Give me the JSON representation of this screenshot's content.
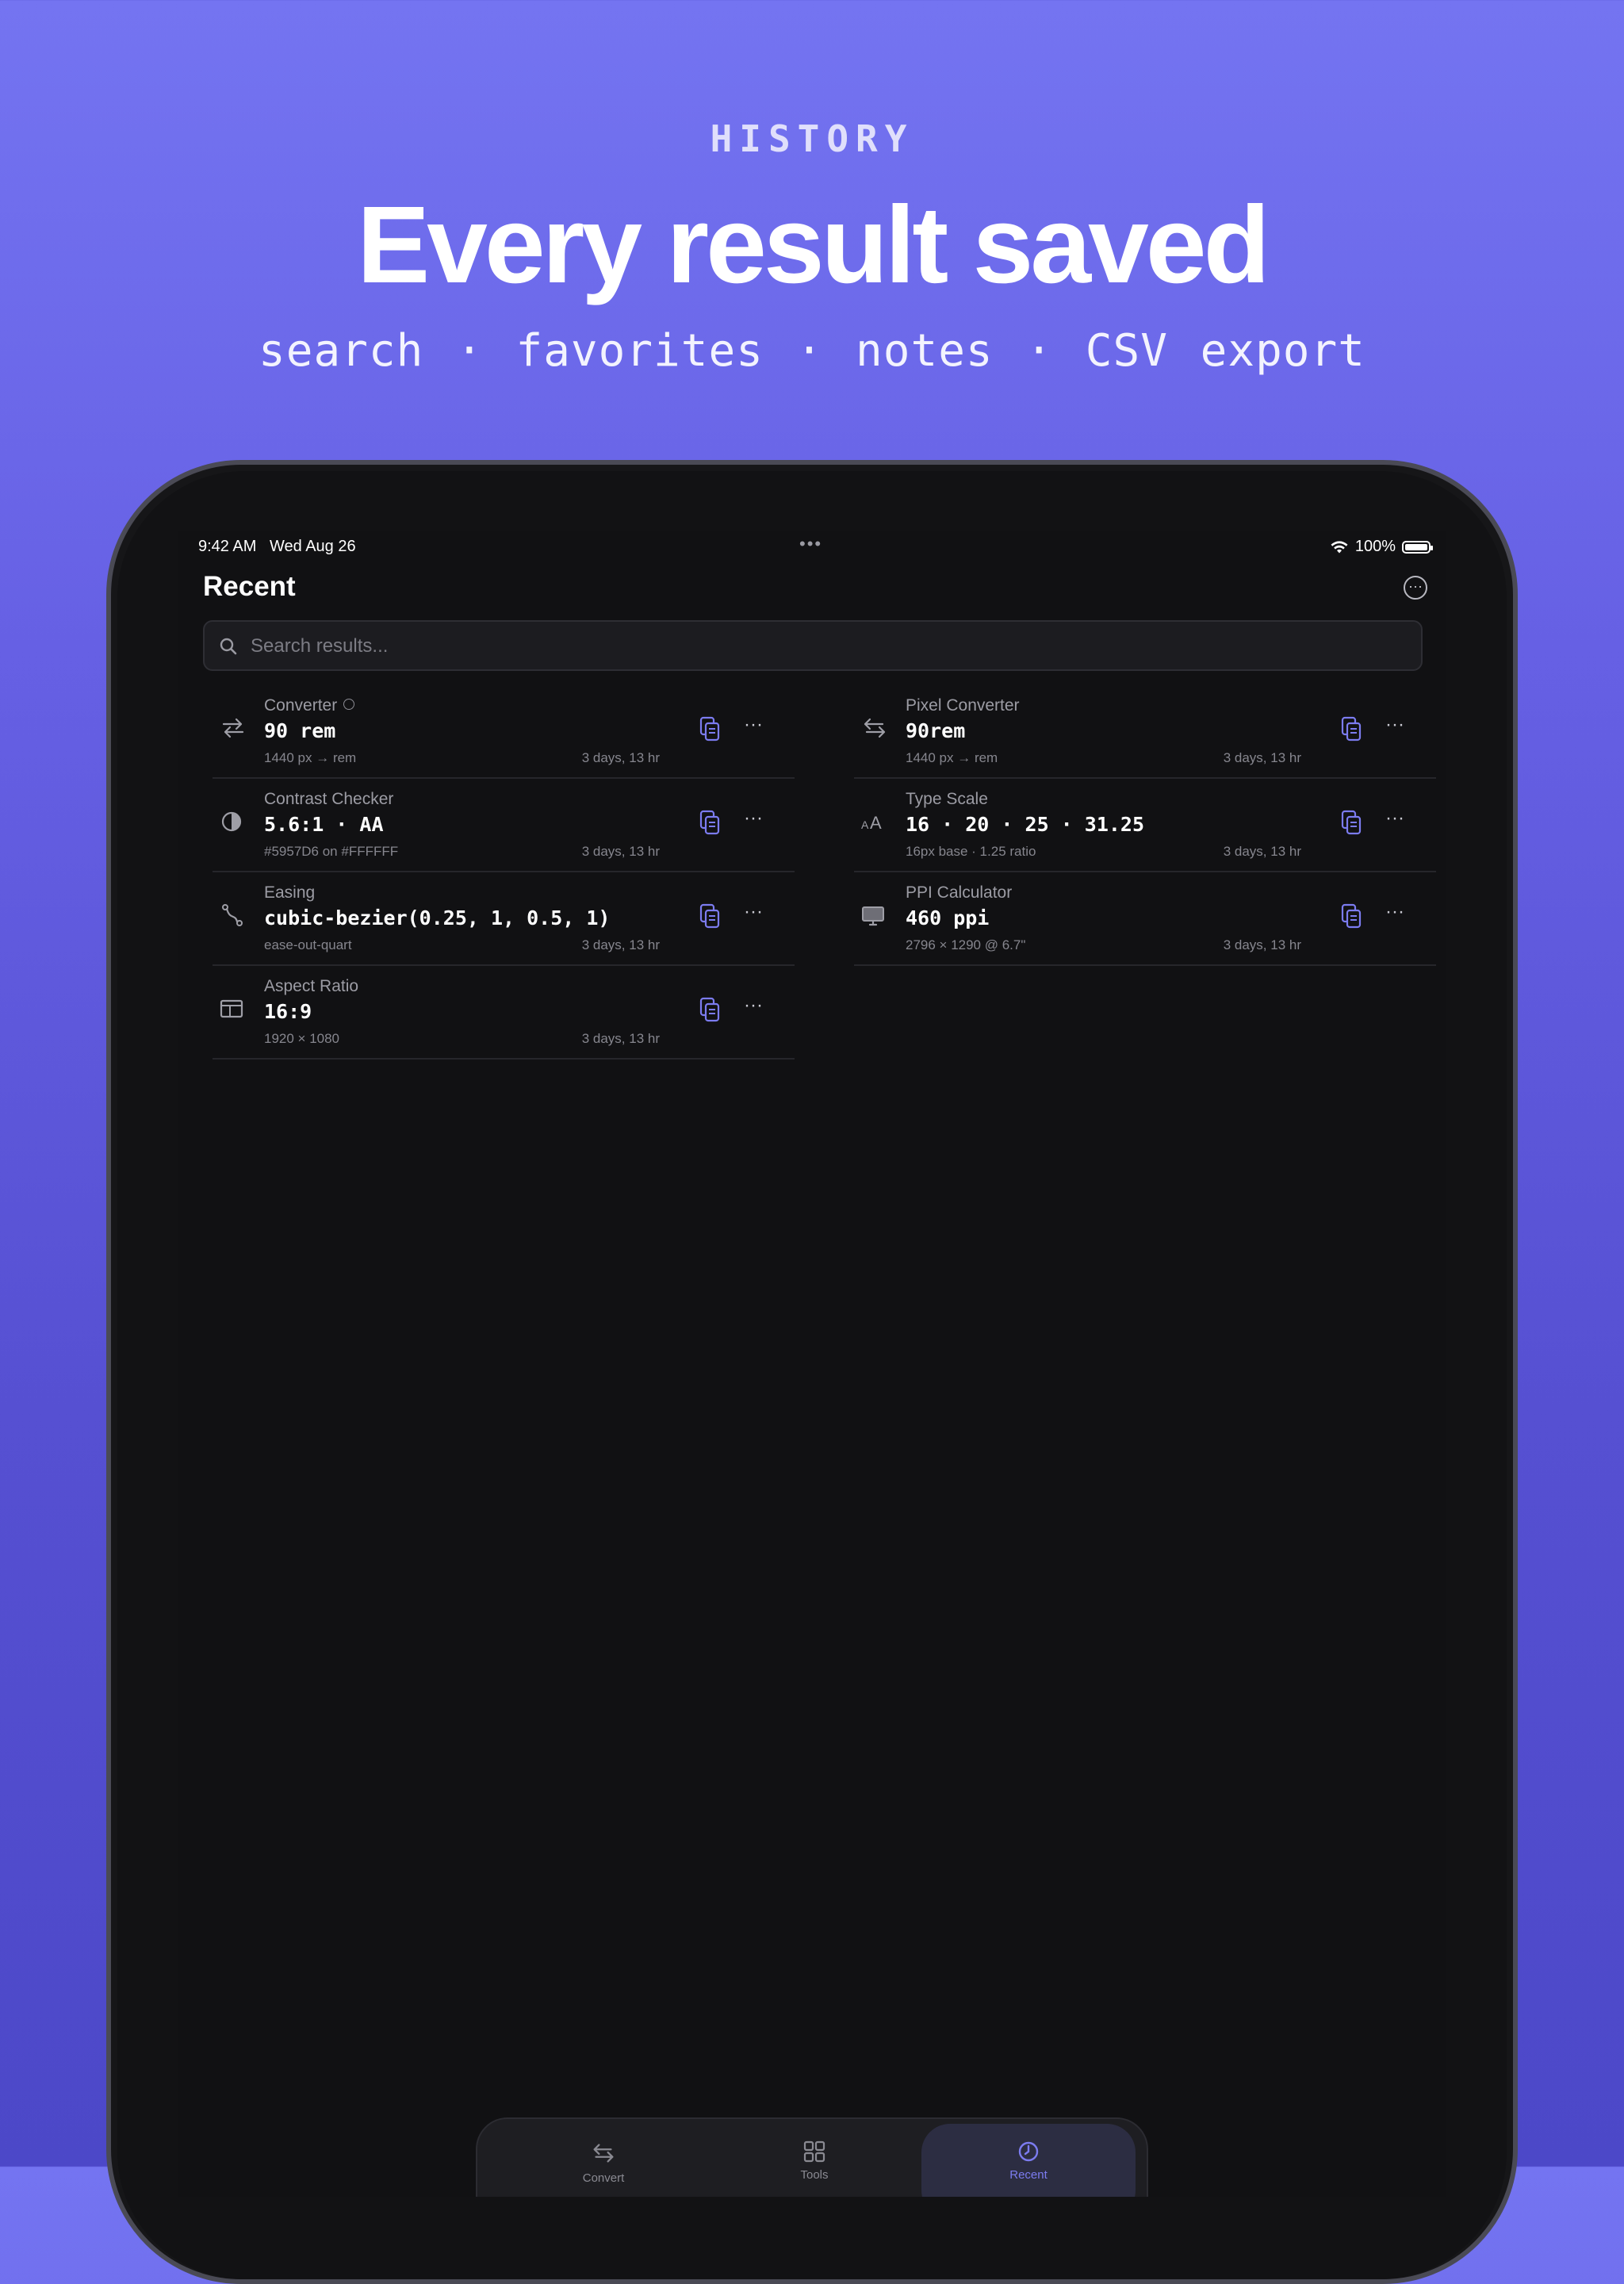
{
  "hero": {
    "eyebrow": "HISTORY",
    "headline": "Every result saved",
    "subline": "search · favorites · notes · CSV export"
  },
  "status_bar": {
    "time": "9:42 AM",
    "date": "Wed Aug 26",
    "battery": "100%"
  },
  "page": {
    "title": "Recent",
    "more_icon": "ellipsis-circle-icon"
  },
  "search": {
    "placeholder": "Search results...",
    "value": ""
  },
  "colors": {
    "accent": "#7C7CF0",
    "background": "#111113",
    "hero_gradient_top": "#7474F1",
    "hero_gradient_bottom": "#4C48C8"
  },
  "results_left": [
    {
      "icon": "arrows-swap-icon",
      "tool": "Converter",
      "value": "90 rem",
      "detail": "1440 px → rem",
      "time": "3 days, 13 hr"
    },
    {
      "icon": "contrast-icon",
      "tool": "Contrast Checker",
      "value": "5.6:1 · AA",
      "detail": "#5957D6 on #FFFFFF",
      "time": "3 days, 13 hr"
    },
    {
      "icon": "bezier-curve-icon",
      "tool": "Easing",
      "value": "cubic-bezier(0.25, 1, 0.5, 1)",
      "detail": "ease-out-quart",
      "time": "3 days, 13 hr"
    },
    {
      "icon": "aspect-ratio-icon",
      "tool": "Aspect Ratio",
      "value": "16:9",
      "detail": "1920 × 1080",
      "time": "3 days, 13 hr"
    }
  ],
  "results_right": [
    {
      "icon": "arrows-swap-icon",
      "tool": "Pixel Converter",
      "value": "90rem",
      "detail": "1440 px → rem",
      "time": "3 days, 13 hr"
    },
    {
      "icon": "type-scale-icon",
      "tool": "Type Scale",
      "value": "16 · 20 · 25 · 31.25",
      "detail": "16px base · 1.25 ratio",
      "time": "3 days, 13 hr"
    },
    {
      "icon": "display-icon",
      "tool": "PPI Calculator",
      "value": "460 ppi",
      "detail": "2796 × 1290 @ 6.7\"",
      "time": "3 days, 13 hr"
    }
  ],
  "tabbar": {
    "tabs": [
      {
        "label": "Convert",
        "icon": "arrows-swap-icon"
      },
      {
        "label": "Tools",
        "icon": "grid-icon"
      },
      {
        "label": "Recent",
        "icon": "clock-icon",
        "active": true
      }
    ]
  }
}
